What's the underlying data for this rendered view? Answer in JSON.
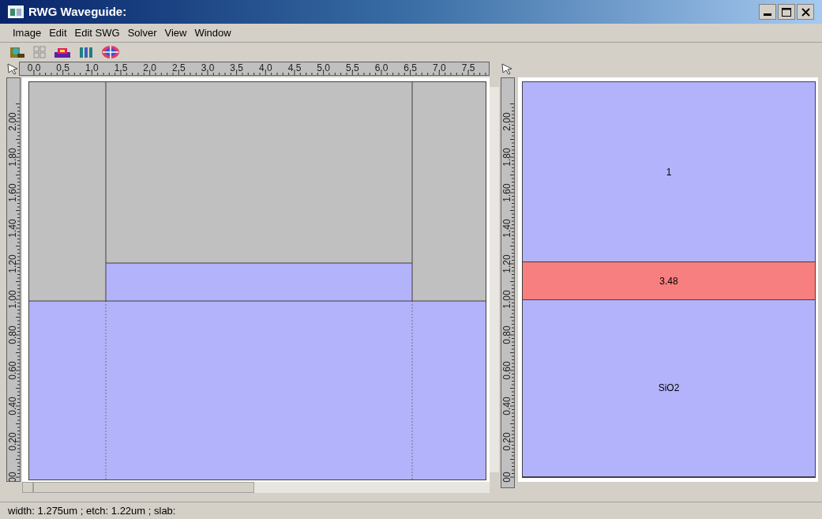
{
  "window": {
    "title": "RWG Waveguide:"
  },
  "menu": [
    "Image",
    "Edit",
    "Edit SWG",
    "Solver",
    "View",
    "Window"
  ],
  "ruler_top": {
    "labels": [
      "0.0",
      "0.5",
      "1.0",
      "1.5",
      "2.0",
      "2.5",
      "3.0",
      "3.5",
      "4.0",
      "4.5",
      "5.0",
      "5.5",
      "6.0",
      "6.5",
      "7.0",
      "7.5"
    ]
  },
  "left_panel": {
    "ruler_labels": [
      "2.00",
      "1.80",
      "1.60",
      "1.40",
      "1.20",
      "1.00",
      "0.80",
      "0.60",
      "0.40",
      "0.20",
      "00"
    ]
  },
  "right_panel": {
    "ruler_labels": [
      "2.00",
      "1.80",
      "1.60",
      "1.40",
      "1.20",
      "1.00",
      "0.80",
      "0.60",
      "0.40",
      "0.20",
      "00"
    ],
    "layers": [
      {
        "label": "1",
        "color": "#b3b3fc"
      },
      {
        "label": "3.48",
        "color": "#f77f7f"
      },
      {
        "label": "SiO2",
        "color": "#b3b3fc"
      }
    ]
  },
  "status_bar": {
    "text": "width: 1.275um ; etch: 1.22um ; slab:"
  }
}
